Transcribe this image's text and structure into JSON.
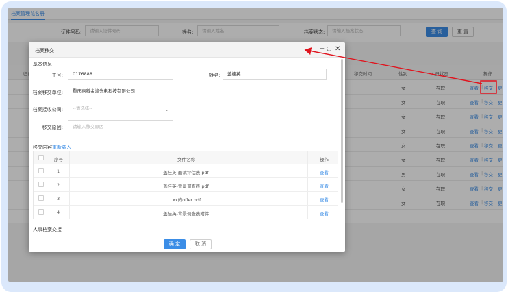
{
  "colors": {
    "accent": "#3b8de6",
    "annotation": "#e0141e"
  },
  "tabbar": {
    "active_tab": "档案管理花名册"
  },
  "filters": {
    "id_label": "证件号码:",
    "id_placeholder": "请输入证件号码",
    "name_label": "姓名:",
    "name_placeholder": "请输入姓名",
    "status_label": "档案状态:",
    "status_placeholder": "请输入档案状态",
    "query_button": "查 询",
    "reset_button": "重 置"
  },
  "grid": {
    "headers": {
      "left_partial": "归口",
      "transfer_time": "移交时间",
      "gender": "性别",
      "staff_status": "人员状态",
      "actions": "操作"
    },
    "rows": [
      {
        "gender": "女",
        "status": "在职"
      },
      {
        "gender": "女",
        "status": "在职"
      },
      {
        "gender": "女",
        "status": "在职"
      },
      {
        "gender": "女",
        "status": "在职"
      },
      {
        "gender": "女",
        "status": "在职"
      },
      {
        "gender": "女",
        "status": "在职"
      },
      {
        "gender": "男",
        "status": "在职"
      },
      {
        "gender": "女",
        "status": "在职"
      },
      {
        "gender": "女",
        "status": "在职"
      }
    ],
    "action_view": "查看",
    "action_transfer": "移交",
    "action_more_partial": "更"
  },
  "modal": {
    "title": "档案移交",
    "controls": {
      "minimize": "−",
      "maximize": "⛶",
      "close": "✕"
    },
    "basic_section": "基本信息",
    "employee_no_label": "工号:",
    "employee_no_value": "0176888",
    "name_label": "姓名:",
    "name_value": "盖桂英",
    "from_unit_label": "档案移交单位:",
    "from_unit_value": "重庆惠科金渝光电科技有限公司",
    "to_company_label": "档案接收公司:",
    "to_company_placeholder": "--请选择--",
    "reason_label": "移交原因:",
    "reason_placeholder": "请输入移交原因",
    "content_label": "移交内容",
    "reload_link": "重新载入",
    "table": {
      "headers": {
        "seq": "序号",
        "filename": "文件名称",
        "action": "操作"
      },
      "rows": [
        {
          "seq": "1",
          "filename": "盖桂英-面试评估表.pdf",
          "action": "查看"
        },
        {
          "seq": "2",
          "filename": "盖桂英-背景调查表.pdf",
          "action": "查看"
        },
        {
          "seq": "3",
          "filename": "xx的offer.pdf",
          "action": "查看"
        },
        {
          "seq": "4",
          "filename": "盖桂英-背景调查表附件",
          "action": "查看"
        }
      ]
    },
    "hr_section": "人事档案交接",
    "ok_button": "确 定",
    "cancel_button": "取 消"
  }
}
